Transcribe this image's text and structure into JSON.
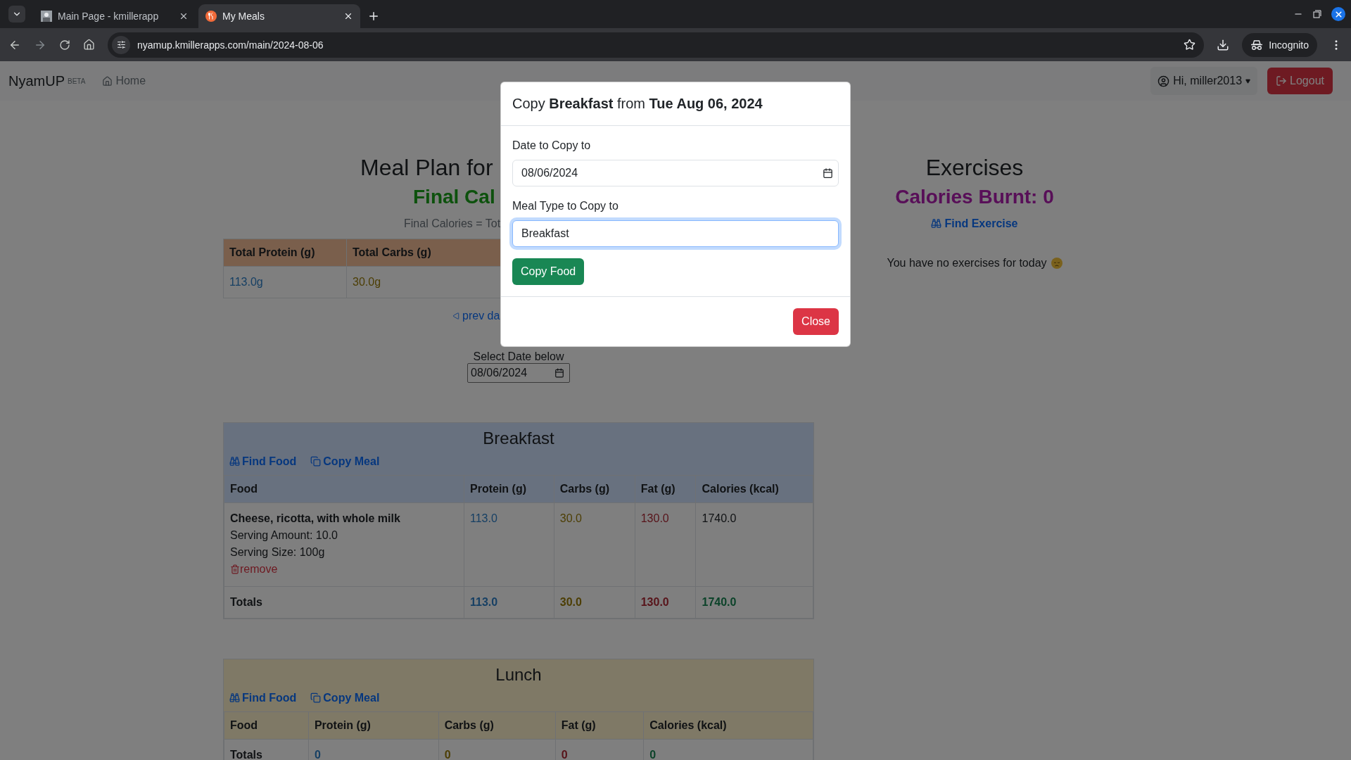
{
  "browser": {
    "tabs": [
      {
        "title": "Main Page - kmillerapp",
        "kind": "photo",
        "selected": false
      },
      {
        "title": "My Meals",
        "kind": "meals",
        "selected": true
      }
    ],
    "url": "nyamup.kmillerapps.com/main/2024-08-06",
    "profile": "Incognito"
  },
  "navbar": {
    "brand": "NyamUP",
    "badge": "BETA",
    "home": "Home",
    "user": "Hi, miller2013",
    "logout": "Logout"
  },
  "meal_plan": {
    "title": "Meal Plan for",
    "final_calories": "Final Cal",
    "formula": "Final Calories = Tot",
    "totals_table": {
      "columns": [
        "Total Protein (g)",
        "Total Carbs (g)"
      ],
      "values": [
        {
          "kind": "protein",
          "text": "113.0g"
        },
        {
          "kind": "carbs",
          "text": "30.0g"
        }
      ]
    },
    "prev_link": "prev da",
    "select_label": "Select Date below",
    "date": "08/06/2024"
  },
  "meals": [
    {
      "name": "Breakfast",
      "color": "#68717f",
      "actions": [
        {
          "kind": "find",
          "label": "Find Food"
        },
        {
          "kind": "copy",
          "label": "Copy Meal"
        }
      ],
      "columns": [
        "Food",
        "Protein (g)",
        "Carbs (g)",
        "Fat (g)",
        "Calories (kcal)"
      ],
      "items": [
        {
          "name": "Cheese, ricotta, with whole milk",
          "amount": "Serving Amount: 10.0",
          "size": "Serving Size: 100g",
          "remove": "remove",
          "protein": "113.0",
          "carbs": "30.0",
          "fat": "130.0",
          "calories": "1740.0"
        }
      ],
      "totals": {
        "label": "Totals",
        "protein": "113.0",
        "carbs": "30.0",
        "fat": "130.0",
        "calories": "1740.0"
      }
    },
    {
      "name": "Lunch",
      "color": "#7f7966",
      "actions": [
        {
          "kind": "find",
          "label": "Find Food"
        },
        {
          "kind": "copy",
          "label": "Copy Meal"
        }
      ],
      "columns": [
        "Food",
        "Protein (g)",
        "Carbs (g)",
        "Fat (g)",
        "Calories (kcal)"
      ],
      "totals": {
        "label": "Totals",
        "protein": "0",
        "carbs": "0",
        "fat": "0",
        "calories": "0"
      }
    }
  ],
  "exercises": {
    "title": "Exercises",
    "calories_burnt": "Calories Burnt: 0",
    "find": "Find Exercise",
    "empty": "You have no exercises for today"
  },
  "modal": {
    "title": "Copy **Breakfast** from **Tue Aug 06, 2024**",
    "date_label": "Date to Copy to",
    "date_value": "08/06/2024",
    "meal_label": "Meal Type to Copy to",
    "meal_value": "Breakfast",
    "meal_focused": true,
    "copy_button": "Copy Food",
    "close_button": "Close"
  }
}
